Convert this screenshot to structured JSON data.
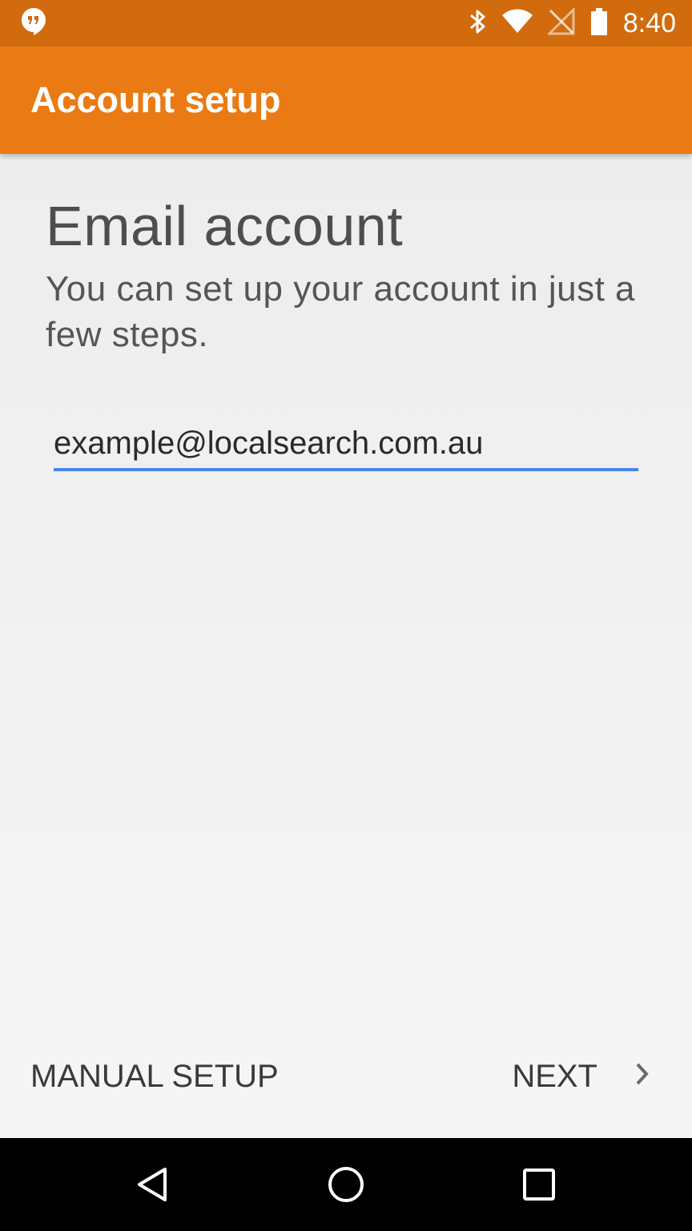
{
  "status_bar": {
    "time": "8:40",
    "icons": [
      "hangouts-icon",
      "bluetooth-icon",
      "wifi-icon",
      "no-signal-icon",
      "battery-icon"
    ],
    "background": "#D16B0D"
  },
  "app_bar": {
    "title": "Account setup",
    "background": "#EA7B14"
  },
  "main": {
    "headline": "Email account",
    "subtext": "You can set up your account in just a few steps.",
    "email_value": "example@localsearch.com.au",
    "accent": "#4A86E8"
  },
  "footer": {
    "manual_setup_label": "MANUAL SETUP",
    "next_label": "NEXT"
  },
  "nav_bar": {
    "buttons": [
      "back-icon",
      "home-icon",
      "recents-icon"
    ]
  }
}
